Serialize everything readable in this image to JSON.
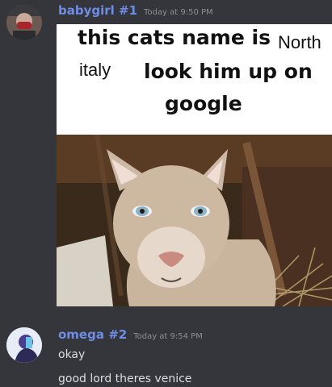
{
  "messages": [
    {
      "author": "babygirl #1",
      "time": "Today at 9:50 PM",
      "meme": {
        "line1_bold": "this cats name is",
        "line1_thin": "North",
        "line2_thin": "italy",
        "line2_bold": "look him up on",
        "line3_bold": "google"
      }
    },
    {
      "author": "omega #2",
      "time": "Today at 9:54 PM",
      "lines": [
        "okay",
        "good lord theres venice"
      ]
    }
  ],
  "colors": {
    "background": "#34363c",
    "author": "#6f8de6",
    "timestamp": "#8b8e93",
    "text": "#dcddde"
  }
}
